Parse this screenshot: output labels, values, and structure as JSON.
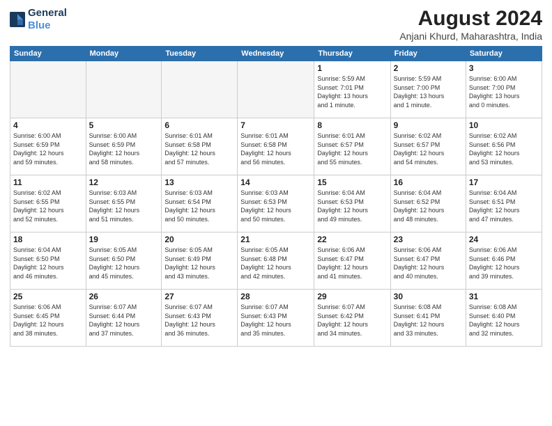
{
  "header": {
    "logo_line1": "General",
    "logo_line2": "Blue",
    "month_year": "August 2024",
    "location": "Anjani Khurd, Maharashtra, India"
  },
  "weekdays": [
    "Sunday",
    "Monday",
    "Tuesday",
    "Wednesday",
    "Thursday",
    "Friday",
    "Saturday"
  ],
  "weeks": [
    [
      {
        "day": "",
        "info": ""
      },
      {
        "day": "",
        "info": ""
      },
      {
        "day": "",
        "info": ""
      },
      {
        "day": "",
        "info": ""
      },
      {
        "day": "1",
        "info": "Sunrise: 5:59 AM\nSunset: 7:01 PM\nDaylight: 13 hours\nand 1 minute."
      },
      {
        "day": "2",
        "info": "Sunrise: 5:59 AM\nSunset: 7:00 PM\nDaylight: 13 hours\nand 1 minute."
      },
      {
        "day": "3",
        "info": "Sunrise: 6:00 AM\nSunset: 7:00 PM\nDaylight: 13 hours\nand 0 minutes."
      }
    ],
    [
      {
        "day": "4",
        "info": "Sunrise: 6:00 AM\nSunset: 6:59 PM\nDaylight: 12 hours\nand 59 minutes."
      },
      {
        "day": "5",
        "info": "Sunrise: 6:00 AM\nSunset: 6:59 PM\nDaylight: 12 hours\nand 58 minutes."
      },
      {
        "day": "6",
        "info": "Sunrise: 6:01 AM\nSunset: 6:58 PM\nDaylight: 12 hours\nand 57 minutes."
      },
      {
        "day": "7",
        "info": "Sunrise: 6:01 AM\nSunset: 6:58 PM\nDaylight: 12 hours\nand 56 minutes."
      },
      {
        "day": "8",
        "info": "Sunrise: 6:01 AM\nSunset: 6:57 PM\nDaylight: 12 hours\nand 55 minutes."
      },
      {
        "day": "9",
        "info": "Sunrise: 6:02 AM\nSunset: 6:57 PM\nDaylight: 12 hours\nand 54 minutes."
      },
      {
        "day": "10",
        "info": "Sunrise: 6:02 AM\nSunset: 6:56 PM\nDaylight: 12 hours\nand 53 minutes."
      }
    ],
    [
      {
        "day": "11",
        "info": "Sunrise: 6:02 AM\nSunset: 6:55 PM\nDaylight: 12 hours\nand 52 minutes."
      },
      {
        "day": "12",
        "info": "Sunrise: 6:03 AM\nSunset: 6:55 PM\nDaylight: 12 hours\nand 51 minutes."
      },
      {
        "day": "13",
        "info": "Sunrise: 6:03 AM\nSunset: 6:54 PM\nDaylight: 12 hours\nand 50 minutes."
      },
      {
        "day": "14",
        "info": "Sunrise: 6:03 AM\nSunset: 6:53 PM\nDaylight: 12 hours\nand 50 minutes."
      },
      {
        "day": "15",
        "info": "Sunrise: 6:04 AM\nSunset: 6:53 PM\nDaylight: 12 hours\nand 49 minutes."
      },
      {
        "day": "16",
        "info": "Sunrise: 6:04 AM\nSunset: 6:52 PM\nDaylight: 12 hours\nand 48 minutes."
      },
      {
        "day": "17",
        "info": "Sunrise: 6:04 AM\nSunset: 6:51 PM\nDaylight: 12 hours\nand 47 minutes."
      }
    ],
    [
      {
        "day": "18",
        "info": "Sunrise: 6:04 AM\nSunset: 6:50 PM\nDaylight: 12 hours\nand 46 minutes."
      },
      {
        "day": "19",
        "info": "Sunrise: 6:05 AM\nSunset: 6:50 PM\nDaylight: 12 hours\nand 45 minutes."
      },
      {
        "day": "20",
        "info": "Sunrise: 6:05 AM\nSunset: 6:49 PM\nDaylight: 12 hours\nand 43 minutes."
      },
      {
        "day": "21",
        "info": "Sunrise: 6:05 AM\nSunset: 6:48 PM\nDaylight: 12 hours\nand 42 minutes."
      },
      {
        "day": "22",
        "info": "Sunrise: 6:06 AM\nSunset: 6:47 PM\nDaylight: 12 hours\nand 41 minutes."
      },
      {
        "day": "23",
        "info": "Sunrise: 6:06 AM\nSunset: 6:47 PM\nDaylight: 12 hours\nand 40 minutes."
      },
      {
        "day": "24",
        "info": "Sunrise: 6:06 AM\nSunset: 6:46 PM\nDaylight: 12 hours\nand 39 minutes."
      }
    ],
    [
      {
        "day": "25",
        "info": "Sunrise: 6:06 AM\nSunset: 6:45 PM\nDaylight: 12 hours\nand 38 minutes."
      },
      {
        "day": "26",
        "info": "Sunrise: 6:07 AM\nSunset: 6:44 PM\nDaylight: 12 hours\nand 37 minutes."
      },
      {
        "day": "27",
        "info": "Sunrise: 6:07 AM\nSunset: 6:43 PM\nDaylight: 12 hours\nand 36 minutes."
      },
      {
        "day": "28",
        "info": "Sunrise: 6:07 AM\nSunset: 6:43 PM\nDaylight: 12 hours\nand 35 minutes."
      },
      {
        "day": "29",
        "info": "Sunrise: 6:07 AM\nSunset: 6:42 PM\nDaylight: 12 hours\nand 34 minutes."
      },
      {
        "day": "30",
        "info": "Sunrise: 6:08 AM\nSunset: 6:41 PM\nDaylight: 12 hours\nand 33 minutes."
      },
      {
        "day": "31",
        "info": "Sunrise: 6:08 AM\nSunset: 6:40 PM\nDaylight: 12 hours\nand 32 minutes."
      }
    ]
  ]
}
